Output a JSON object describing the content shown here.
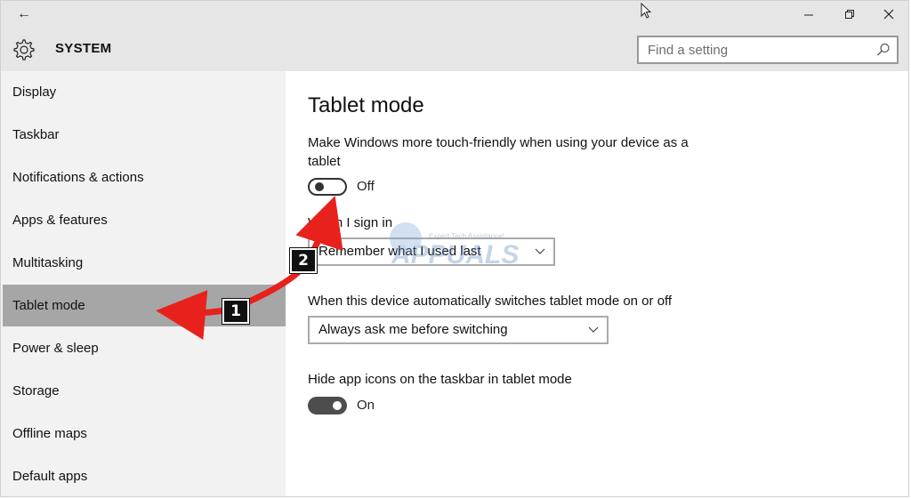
{
  "window": {
    "back_glyph": "←",
    "app_title": "SYSTEM",
    "controls": [
      "minimize-icon",
      "restore-icon",
      "close-icon"
    ]
  },
  "search": {
    "placeholder": "Find a setting"
  },
  "sidebar": {
    "items": [
      {
        "label": "Display",
        "active": false
      },
      {
        "label": "Taskbar",
        "active": false
      },
      {
        "label": "Notifications & actions",
        "active": false
      },
      {
        "label": "Apps & features",
        "active": false
      },
      {
        "label": "Multitasking",
        "active": false
      },
      {
        "label": "Tablet mode",
        "active": true
      },
      {
        "label": "Power & sleep",
        "active": false
      },
      {
        "label": "Storage",
        "active": false
      },
      {
        "label": "Offline maps",
        "active": false
      },
      {
        "label": "Default apps",
        "active": false
      }
    ]
  },
  "main": {
    "title": "Tablet mode",
    "touch_desc_line1": "Make Windows more touch-friendly when using your device as a",
    "touch_desc_line2": "tablet",
    "touch_toggle": {
      "state": "off",
      "label": "Off"
    },
    "signin_label": "When I sign in",
    "signin_value": "Remember what I used last",
    "switch_label": "When this device automatically switches tablet mode on or off",
    "switch_value": "Always ask me before switching",
    "hide_icons_label": "Hide app icons on the taskbar in tablet mode",
    "hide_icons_toggle": {
      "state": "on",
      "label": "On"
    }
  },
  "annotations": {
    "badge1": "1",
    "badge2": "2",
    "arrow_color": "#e8211d"
  },
  "watermark": {
    "text": "APPUALS",
    "tagline": "Expert Tech Assistance!"
  },
  "colors": {
    "titlebar_bg": "#e6e6e6",
    "sidebar_bg": "#f2f2f2",
    "active_item_bg": "#a6a6a6"
  }
}
